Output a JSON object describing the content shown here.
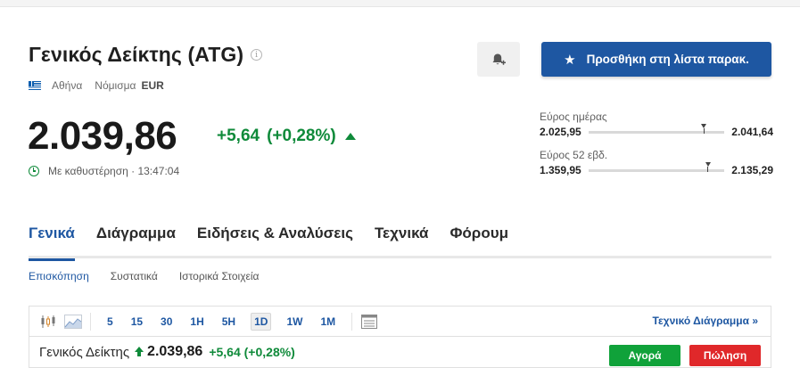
{
  "header": {
    "title": "Γενικός Δείκτης (ATG)",
    "info_icon": "info-icon",
    "exchange": "Αθήνα",
    "currency_label": "Νόμισμα",
    "currency": "EUR",
    "alert_icon": "bell-plus-icon",
    "add_to_watchlist": "Προσθήκη στη λίστα παρακ."
  },
  "quote": {
    "price": "2.039,86",
    "change": "+5,64",
    "change_pct": "(+0,28%)",
    "direction": "up",
    "delay_text": "Με καθυστέρηση · 13:47:04"
  },
  "ranges": {
    "day": {
      "label": "Εύρος ημέρας",
      "low": "2.025,95",
      "high": "2.041,64",
      "marker_fraction": 0.85
    },
    "week52": {
      "label": "Εύρος 52 εβδ.",
      "low": "1.359,95",
      "high": "2.135,29",
      "marker_fraction": 0.88
    }
  },
  "tabs": [
    "Γενικά",
    "Διάγραμμα",
    "Ειδήσεις & Αναλύσεις",
    "Τεχνικά",
    "Φόρουμ"
  ],
  "active_tab": "Γενικά",
  "subtabs": [
    "Επισκόπηση",
    "Συστατικά",
    "Ιστορικά Στοιχεία"
  ],
  "active_subtab": "Επισκόπηση",
  "chart_toolbar": {
    "periods": [
      "5",
      "15",
      "30",
      "1H",
      "5H",
      "1D",
      "1W",
      "1M"
    ],
    "selected_period": "1D",
    "technical_chart_link": "Τεχνικό Διάγραμμα »"
  },
  "quote_bar": {
    "name": "Γενικός Δείκτης",
    "price": "2.039,86",
    "change": "+5,64 (+0,28%)",
    "buy": "Αγορά",
    "sell": "Πώληση"
  },
  "colors": {
    "brand_blue": "#1e57a2",
    "up_green": "#0f8a3a",
    "buy_green": "#10a23a",
    "sell_red": "#e0282a"
  }
}
